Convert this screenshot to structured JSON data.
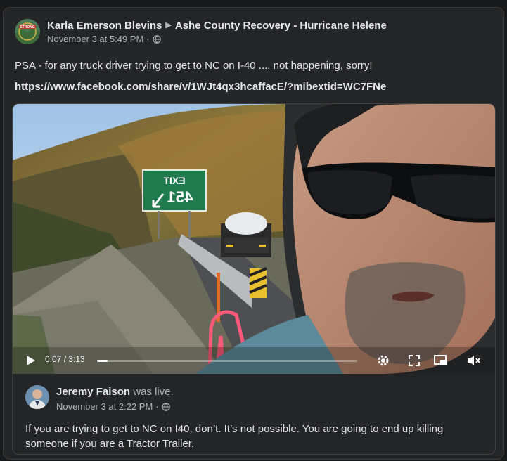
{
  "post": {
    "author": "Karla Emerson Blevins",
    "group": "Ashe County Recovery - Hurricane Helene",
    "timestamp": "November 3 at 5:49 PM",
    "separator": "·",
    "text": "PSA - for any truck driver trying to get to NC on I-40 .... not happening, sorry!",
    "link": "https://www.facebook.com/share/v/1WJt4qx3hcaffacE/?mibextid=WC7FNe"
  },
  "video": {
    "sign_text_line1": "EXIT",
    "sign_text_line2": "451",
    "time": "0:07 / 3:13",
    "progress": 0.04
  },
  "shared_post": {
    "author": "Jeremy Faison",
    "status": "was live.",
    "timestamp": "November 3 at 2:22 PM",
    "separator": "·",
    "text": "If you are trying to get to NC on I40, don’t.  It’s not possible. You are going to end up killing someone if you are a Tractor Trailer."
  },
  "colors": {
    "background": "#18191a",
    "card": "#242526",
    "primary_text": "#e4e6eb",
    "secondary_text": "#b0b3b8",
    "sign_green": "#1f7a4d"
  },
  "icons": {
    "author_avatar": "strong-logo-avatar",
    "breadcrumb": "triangle-right-icon",
    "privacy": "globe-icon",
    "play": "play-icon",
    "settings": "gear-icon",
    "fullscreen": "expand-icon",
    "pip": "picture-in-picture-icon",
    "mute": "volume-muted-icon"
  }
}
